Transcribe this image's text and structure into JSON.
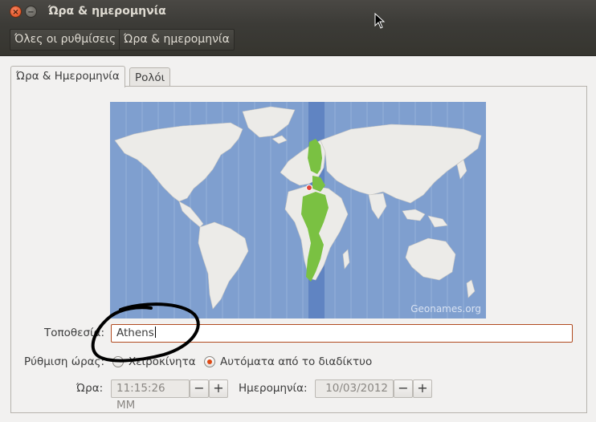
{
  "window": {
    "title": "Ώρα & ημερομηνία"
  },
  "toolbar": {
    "all_settings": "Όλες οι ρυθμίσεις",
    "breadcrumb_current": "Ώρα & ημερομηνία"
  },
  "tabs": [
    {
      "label": "Ώρα & Ημερομηνία"
    },
    {
      "label": "Ρολόι"
    }
  ],
  "map": {
    "credit": "Geonames.org",
    "selected_city_marker": "pin"
  },
  "location": {
    "label": "Τοποθεσία:",
    "value": "Athens"
  },
  "time_setting": {
    "label": "Ρύθμιση ώρας:",
    "manual_label": "Χειροκίνητα",
    "auto_label": "Αυτόματα από το διαδίκτυο",
    "selected": "auto"
  },
  "time": {
    "label": "Ώρα:",
    "value": "11:15:26 MM",
    "minus": "−",
    "plus": "+"
  },
  "date": {
    "label": "Ημερομηνία:",
    "value": "10/03/2012",
    "minus": "−",
    "plus": "+"
  },
  "colors": {
    "accent": "#dd4814",
    "ocean": "#7f9fcf",
    "land": "#ecebe8",
    "zone": "#7ac142",
    "zone_band": "#5a7fc0"
  }
}
